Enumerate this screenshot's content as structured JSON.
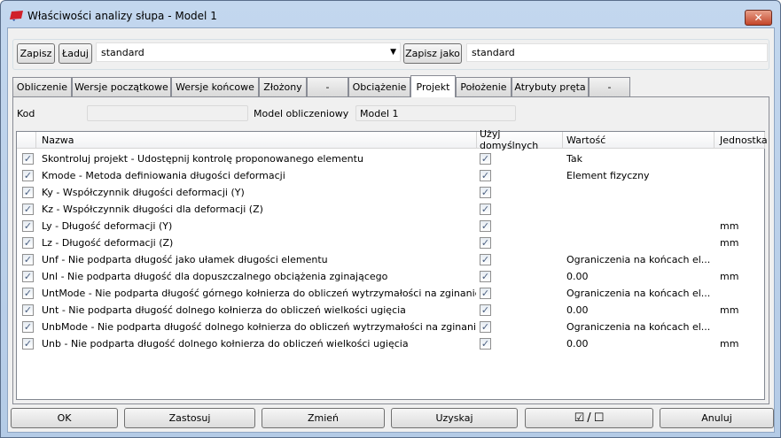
{
  "window": {
    "title": "Właściwości analizy słupa - Model 1",
    "close": "✕",
    "accent": "#c4462a"
  },
  "toolbar": {
    "save": "Zapisz",
    "load": "Ładuj",
    "preset": "standard",
    "save_as": "Zapisz jako",
    "save_as_name": "standard"
  },
  "tabs": [
    "Obliczenie",
    "Wersje początkowe",
    "Wersje końcowe",
    "Złożony",
    "-",
    "Obciążenie",
    "Projekt",
    "Położenie",
    "Atrybuty pręta",
    "-"
  ],
  "active_tab": "Projekt",
  "fields": {
    "code_label": "Kod",
    "code_value": "",
    "model_label": "Model obliczeniowy",
    "model_value": "Model 1"
  },
  "table": {
    "headers": [
      "Nazwa",
      "Użyj domyślnych",
      "Wartość",
      "Jednostka"
    ],
    "rows": [
      {
        "checked": true,
        "name": "Skontroluj projekt - Udostępnij kontrolę proponowanego elementu",
        "default": true,
        "value": "Tak",
        "unit": ""
      },
      {
        "checked": true,
        "name": "Kmode - Metoda definiowania długości deformacji",
        "default": true,
        "value": "Element fizyczny",
        "unit": ""
      },
      {
        "checked": true,
        "name": "Ky - Współczynnik długości deformacji (Y)",
        "default": true,
        "value": "",
        "unit": ""
      },
      {
        "checked": true,
        "name": "Kz - Współczynnik długości dla deformacji (Z)",
        "default": true,
        "value": "",
        "unit": ""
      },
      {
        "checked": true,
        "name": "Ly - Długość deformacji (Y)",
        "default": true,
        "value": "",
        "unit": "mm"
      },
      {
        "checked": true,
        "name": "Lz - Długość deformacji (Z)",
        "default": true,
        "value": "",
        "unit": "mm"
      },
      {
        "checked": true,
        "name": "Unf - Nie podparta długość jako ułamek długości elementu",
        "default": true,
        "value": "Ograniczenia na końcach el...",
        "unit": ""
      },
      {
        "checked": true,
        "name": "Unl - Nie podparta długość dla dopuszczalnego obciążenia zginającego",
        "default": true,
        "value": "0.00",
        "unit": "mm"
      },
      {
        "checked": true,
        "name": "UntMode - Nie podparta długość górnego kołnierza do obliczeń wytrzymałości na zginanie",
        "default": true,
        "value": "Ograniczenia na końcach el...",
        "unit": ""
      },
      {
        "checked": true,
        "name": "Unt - Nie podparta długość dolnego kołnierza do obliczeń wielkości ugięcia",
        "default": true,
        "value": "0.00",
        "unit": "mm"
      },
      {
        "checked": true,
        "name": "UnbMode - Nie podparta długość dolnego kołnierza do obliczeń wytrzymałości na zginanie",
        "default": true,
        "value": "Ograniczenia na końcach el...",
        "unit": ""
      },
      {
        "checked": true,
        "name": "Unb - Nie podparta długość dolnego kołnierza do obliczeń wielkości ugięcia",
        "default": true,
        "value": "0.00",
        "unit": "mm"
      }
    ]
  },
  "buttons": {
    "ok": "OK",
    "apply": "Zastosuj",
    "modify": "Zmień",
    "get": "Uzyskaj",
    "toggle_on": "☑",
    "toggle_sep": "/",
    "toggle_off": "☐",
    "cancel": "Anuluj"
  }
}
